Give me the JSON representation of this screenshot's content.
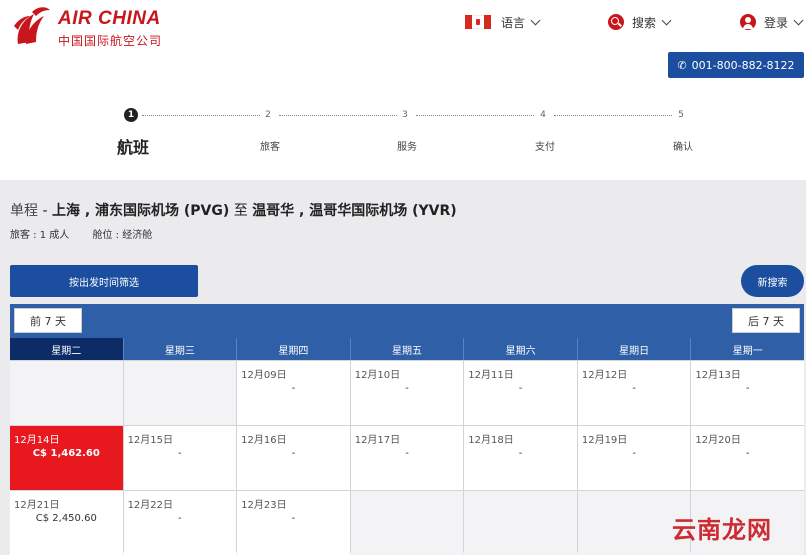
{
  "brand": {
    "name_en": "AIR CHINA",
    "name_cn": "中国国际航空公司",
    "color": "#c8161d"
  },
  "header": {
    "language_label": "语言",
    "search_label": "搜索",
    "login_label": "登录",
    "phone": "001-800-882-8122",
    "icons": [
      "canada-flag-icon",
      "search-icon",
      "user-icon",
      "phone-icon"
    ]
  },
  "steps": [
    {
      "num": "1",
      "label": "航班",
      "active": true
    },
    {
      "num": "2",
      "label": "旅客",
      "active": false
    },
    {
      "num": "3",
      "label": "服务",
      "active": false
    },
    {
      "num": "4",
      "label": "支付",
      "active": false
    },
    {
      "num": "5",
      "label": "确认",
      "active": false
    }
  ],
  "trip": {
    "type": "单程",
    "sep1": " - ",
    "origin": "上海 , 浦东国际机场 (PVG)",
    "to": " 至 ",
    "destination": "温哥华 , 温哥华国际机场 (YVR)",
    "passengers": "旅客 : 1 成人",
    "cabin": "舱位 : 经济舱"
  },
  "buttons": {
    "filter": "按出发时间筛选",
    "new_search": "新搜索",
    "prev": "前 7 天",
    "next": "后 7 天"
  },
  "calendar": {
    "days": [
      "星期二",
      "星期三",
      "星期四",
      "星期五",
      "星期六",
      "星期日",
      "星期一"
    ],
    "active_day": 0,
    "rows": [
      [
        {
          "date": "",
          "price": ""
        },
        {
          "date": "",
          "price": ""
        },
        {
          "date": "12月09日",
          "price": "-"
        },
        {
          "date": "12月10日",
          "price": "-"
        },
        {
          "date": "12月11日",
          "price": "-"
        },
        {
          "date": "12月12日",
          "price": "-"
        },
        {
          "date": "12月13日",
          "price": "-"
        }
      ],
      [
        {
          "date": "12月14日",
          "price": "C$ 1,462.60",
          "selected": true
        },
        {
          "date": "12月15日",
          "price": "-"
        },
        {
          "date": "12月16日",
          "price": "-"
        },
        {
          "date": "12月17日",
          "price": "-"
        },
        {
          "date": "12月18日",
          "price": "-"
        },
        {
          "date": "12月19日",
          "price": "-"
        },
        {
          "date": "12月20日",
          "price": "-"
        }
      ],
      [
        {
          "date": "12月21日",
          "price": "C$ 2,450.60"
        },
        {
          "date": "12月22日",
          "price": "-"
        },
        {
          "date": "12月23日",
          "price": "-"
        },
        {
          "date": "",
          "price": ""
        },
        {
          "date": "",
          "price": ""
        },
        {
          "date": "",
          "price": ""
        },
        {
          "date": "",
          "price": ""
        }
      ]
    ]
  },
  "watermark": "云南龙网"
}
